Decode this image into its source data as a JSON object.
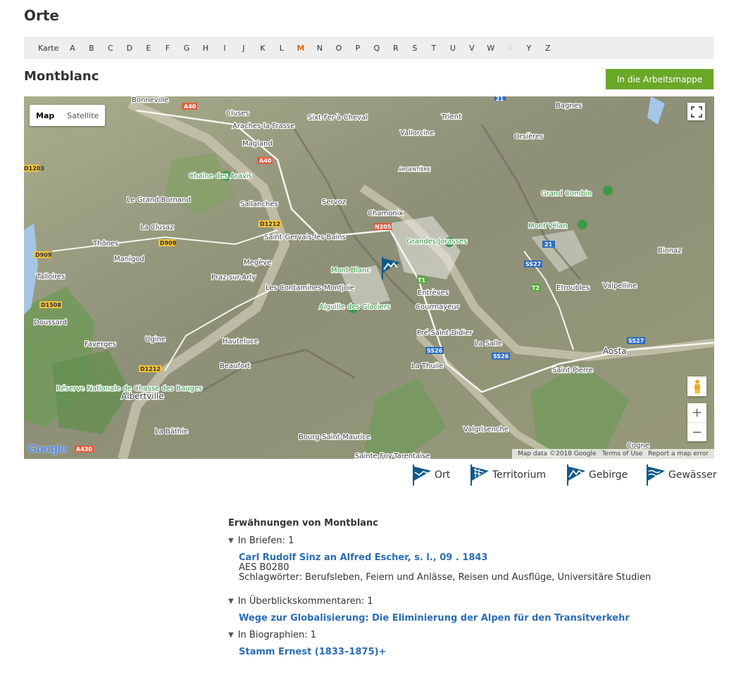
{
  "header": {
    "title": "Orte"
  },
  "alphabet": {
    "map_label": "Karte",
    "letters": [
      {
        "l": "A",
        "state": "normal"
      },
      {
        "l": "B",
        "state": "normal"
      },
      {
        "l": "C",
        "state": "normal"
      },
      {
        "l": "D",
        "state": "normal"
      },
      {
        "l": "E",
        "state": "normal"
      },
      {
        "l": "F",
        "state": "normal"
      },
      {
        "l": "G",
        "state": "normal"
      },
      {
        "l": "H",
        "state": "normal"
      },
      {
        "l": "I",
        "state": "normal"
      },
      {
        "l": "J",
        "state": "normal"
      },
      {
        "l": "K",
        "state": "normal"
      },
      {
        "l": "L",
        "state": "normal"
      },
      {
        "l": "M",
        "state": "active"
      },
      {
        "l": "N",
        "state": "normal"
      },
      {
        "l": "O",
        "state": "normal"
      },
      {
        "l": "P",
        "state": "normal"
      },
      {
        "l": "Q",
        "state": "normal"
      },
      {
        "l": "R",
        "state": "normal"
      },
      {
        "l": "S",
        "state": "normal"
      },
      {
        "l": "T",
        "state": "normal"
      },
      {
        "l": "U",
        "state": "normal"
      },
      {
        "l": "V",
        "state": "normal"
      },
      {
        "l": "W",
        "state": "normal"
      },
      {
        "l": "X",
        "state": "disabled"
      },
      {
        "l": "Y",
        "state": "normal"
      },
      {
        "l": "Z",
        "state": "normal"
      }
    ]
  },
  "place": {
    "title": "Montblanc",
    "workbook_button": "In die Arbeitsmappe"
  },
  "map": {
    "type_map": "Map",
    "type_satellite": "Satellite",
    "footer_data": "Map data ©2018 Google",
    "footer_terms": "Terms of Use",
    "footer_report": "Report a map error",
    "google_logo": "Google",
    "places": [
      "Bonneville",
      "Cluses",
      "Araches-la-Frasse",
      "Sixt-Fer-à-Cheval",
      "Trient",
      "Bagnes",
      "Vallorcine",
      "Orsières",
      "Magland",
      "ARGENTIÈRE",
      "Chaîne des Aravis",
      "Grand Combin",
      "Le Grand-Bornand",
      "Sallanches",
      "Servoz",
      "Chamonix",
      "Mont Vélan",
      "La Clusaz",
      "Saint-Gervais-les-Bains",
      "Grandes Jorasses",
      "Thônes",
      "Bionaz",
      "Manigod",
      "Megève",
      "Mont Blanc",
      "Talloires",
      "Praz-sur-Arly",
      "Entrèves",
      "Etroubles",
      "Valpelline",
      "Les Contamines-Montjoie",
      "Aiguille des Glaciers",
      "Courmayeur",
      "Doussard",
      "Pré-Saint-Didier",
      "Faverges",
      "Ugine",
      "Hauteluce",
      "La Salle",
      "Aosta",
      "Beaufort",
      "La Thuile",
      "Saint-Pierre",
      "Réserve Nationale de Chasse des Bauges",
      "Albertville",
      "La Bâthie",
      "Valgrisenche",
      "Bourg-Saint-Maurice",
      "Sainte-Foy-Tarentaise",
      "Cogne"
    ],
    "roads": [
      "A40",
      "A40",
      "D1203",
      "D1212",
      "N205",
      "D909",
      "D909",
      "SS26",
      "SS26",
      "SS27",
      "SS27",
      "D1508",
      "D1212",
      "A430",
      "21",
      "21",
      "T1",
      "T2"
    ]
  },
  "legend": [
    "Ort",
    "Territorium",
    "Gebirge",
    "Gewässer"
  ],
  "mentions": {
    "heading": "Erwähnungen von Montblanc",
    "letters_label": "In Briefen: 1",
    "letter_title": "Carl Rudolf Sinz an Alfred Escher, s. l., 09 . 1843",
    "letter_signature": "AES B0280",
    "letter_keywords": "Schlagwörter: Berufsleben, Feiern und Anlässe, Reisen und Ausflüge, Universitäre Studien",
    "overview_label": "In Überblickskommentaren: 1",
    "overview_title": "Wege zur Globalisierung: Die Eliminierung der Alpen für den Transitverkehr",
    "bio_label": "In Biographien: 1",
    "bio_title": "Stamm Ernest (1833–1875)+"
  },
  "colors": {
    "accent": "#e06a12",
    "button": "#6aa828",
    "link": "#2a6db5",
    "pin": "#0e5a8a"
  }
}
